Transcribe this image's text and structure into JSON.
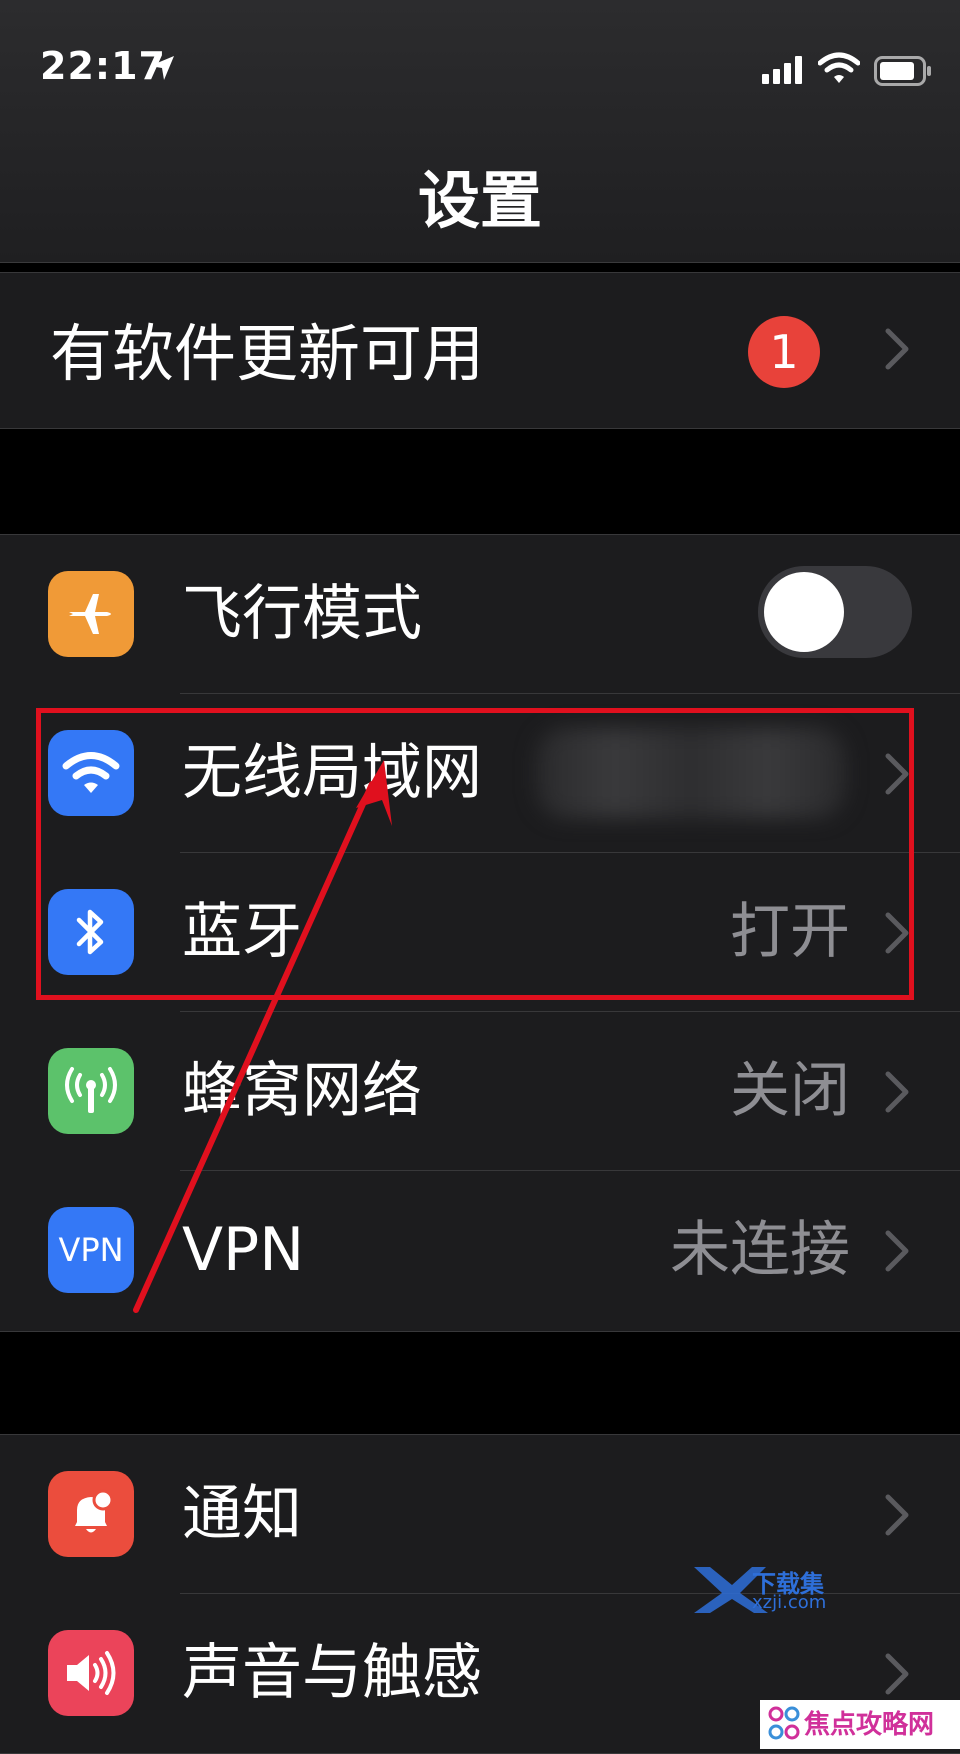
{
  "status_bar": {
    "time": "22:17"
  },
  "header": {
    "title": "设置"
  },
  "update_group": {
    "label": "有软件更新可用",
    "badge_count": "1"
  },
  "connectivity": [
    {
      "label": "飞行模式",
      "icon": "airplane-icon",
      "icon_color": "#f09a37",
      "toggle_on": false
    },
    {
      "label": "无线局域网",
      "icon": "wifi-icon",
      "icon_color": "#3478f6",
      "value": ""
    },
    {
      "label": "蓝牙",
      "icon": "bluetooth-icon",
      "icon_color": "#3478f6",
      "value": "打开"
    },
    {
      "label": "蜂窝网络",
      "icon": "antenna-icon",
      "icon_color": "#5cc26b",
      "value": "关闭"
    },
    {
      "label": "VPN",
      "icon": "vpn-icon",
      "icon_color": "#3478f6",
      "icon_text": "VPN",
      "value": "未连接"
    }
  ],
  "notifications_group": [
    {
      "label": "通知",
      "icon": "bell-icon",
      "icon_color": "#eb4d3d"
    },
    {
      "label": "声音与触感",
      "icon": "speaker-icon",
      "icon_color": "#eb445a"
    }
  ],
  "watermarks": {
    "xzji_name": "下载集",
    "xzji_url": "xzji.com",
    "jiaodian_name": "焦点攻略网"
  }
}
